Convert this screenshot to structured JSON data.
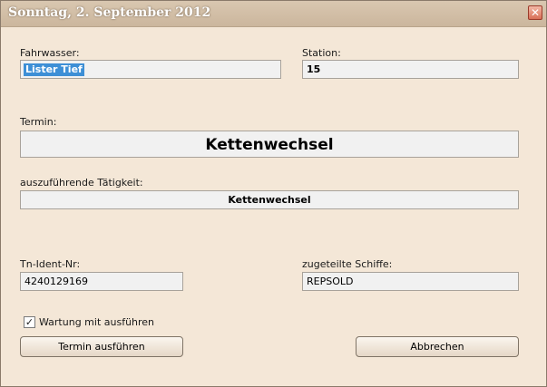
{
  "window": {
    "title": "Sonntag, 2. September 2012",
    "close_glyph": "✕"
  },
  "form": {
    "fahrwasser_label": "Fahrwasser:",
    "fahrwasser_value": "Lister Tief",
    "station_label": "Station:",
    "station_value": "15",
    "termin_label": "Termin:",
    "termin_value": "Kettenwechsel",
    "taetigkeit_label": "auszuführende Tätigkeit:",
    "taetigkeit_value": "Kettenwechsel",
    "tn_ident_label": "Tn-Ident-Nr:",
    "tn_ident_value": "4240129169",
    "schiffe_label": "zugeteilte Schiffe:",
    "schiffe_value": "REPSOLD",
    "wartung_label": "Wartung mit ausführen",
    "wartung_checked": true,
    "check_glyph": "✓"
  },
  "buttons": {
    "execute_label": "Termin ausführen",
    "cancel_label": "Abbrechen"
  },
  "colors": {
    "titlebar": "#d1bea6",
    "client_bg": "#f4e7d7",
    "selection": "#3d8fd6",
    "close_button": "#d86f57"
  }
}
